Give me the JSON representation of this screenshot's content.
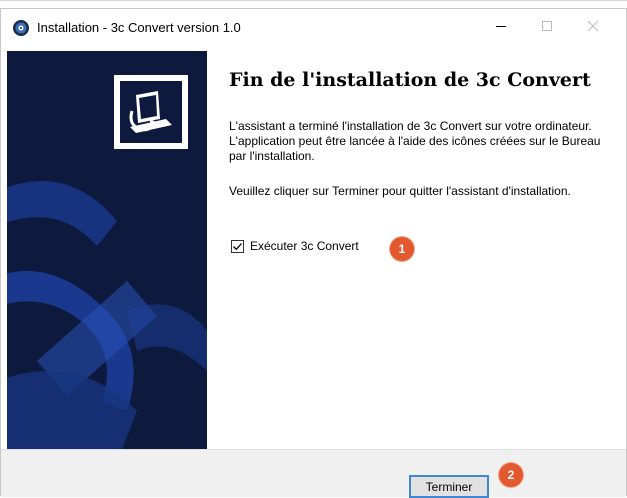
{
  "window": {
    "title": "Installation - 3c Convert version 1.0",
    "icon": "app-disc-icon"
  },
  "titlebar_buttons": {
    "minimize": "minimize-icon",
    "maximize": "maximize-icon",
    "close": "close-icon"
  },
  "content": {
    "heading": "Fin de l'installation de 3c Convert",
    "paragraph1": "L'assistant a terminé l'installation de 3c Convert sur votre ordinateur. L'application peut être lancée à l'aide des icônes créées sur le Bureau par l'installation.",
    "paragraph2": "Veuillez cliquer sur Terminer pour quitter l'assistant d'installation.",
    "checkbox": {
      "label": "Exécuter 3c Convert",
      "checked": true
    }
  },
  "markers": {
    "first": "1",
    "second": "2"
  },
  "footer": {
    "finish_label": "Terminer"
  },
  "colors": {
    "banner": "#0d1a3e",
    "banner_accent": "#1d3f9c",
    "marker": "#e2582f",
    "focus_border": "#3f86d3"
  }
}
